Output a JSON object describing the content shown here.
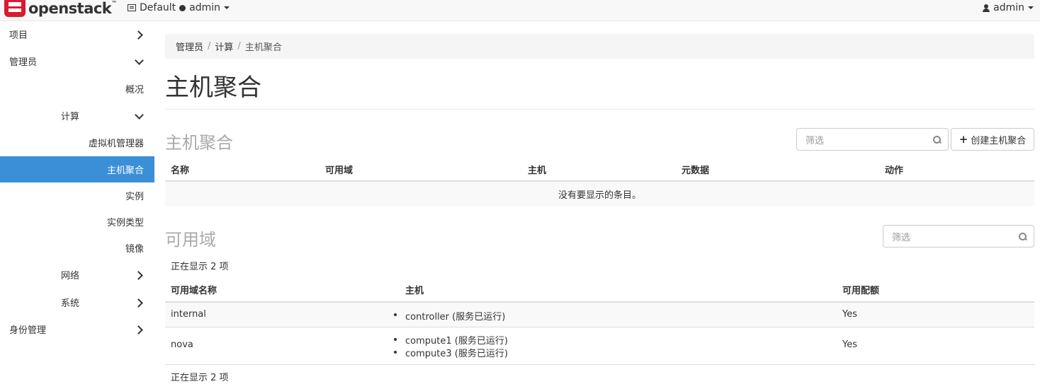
{
  "navbar": {
    "brand": "openstack",
    "brand_mark": "™",
    "project_domain": "Default",
    "project_name": "admin",
    "user": "admin"
  },
  "sidebar": {
    "items": [
      {
        "label": "项目"
      },
      {
        "label": "管理员"
      },
      {
        "label": "概况"
      },
      {
        "label": "计算"
      },
      {
        "label": "虚拟机管理器"
      },
      {
        "label": "主机聚合"
      },
      {
        "label": "实例"
      },
      {
        "label": "实例类型"
      },
      {
        "label": "镜像"
      },
      {
        "label": "网络"
      },
      {
        "label": "系统"
      },
      {
        "label": "身份管理"
      }
    ]
  },
  "breadcrumb": {
    "items": [
      "管理员",
      "计算"
    ],
    "separator": "/",
    "current": "主机聚合"
  },
  "page": {
    "title": "主机聚合"
  },
  "aggregates": {
    "title": "主机聚合",
    "filter_placeholder": "筛选",
    "create_button": "创建主机聚合",
    "columns": [
      "名称",
      "可用域",
      "主机",
      "元数据",
      "动作"
    ],
    "empty_message": "没有要显示的条目。"
  },
  "zones": {
    "title": "可用域",
    "filter_placeholder": "筛选",
    "count_text_top": "正在显示 2 项",
    "count_text_bottom": "正在显示 2 项",
    "columns": [
      "可用域名称",
      "主机",
      "可用配额"
    ],
    "rows": [
      {
        "name": "internal",
        "hosts": [
          "controller (服务已运行)"
        ],
        "available": "Yes"
      },
      {
        "name": "nova",
        "hosts": [
          "compute1 (服务已运行)",
          "compute3 (服务已运行)"
        ],
        "available": "Yes"
      }
    ]
  }
}
